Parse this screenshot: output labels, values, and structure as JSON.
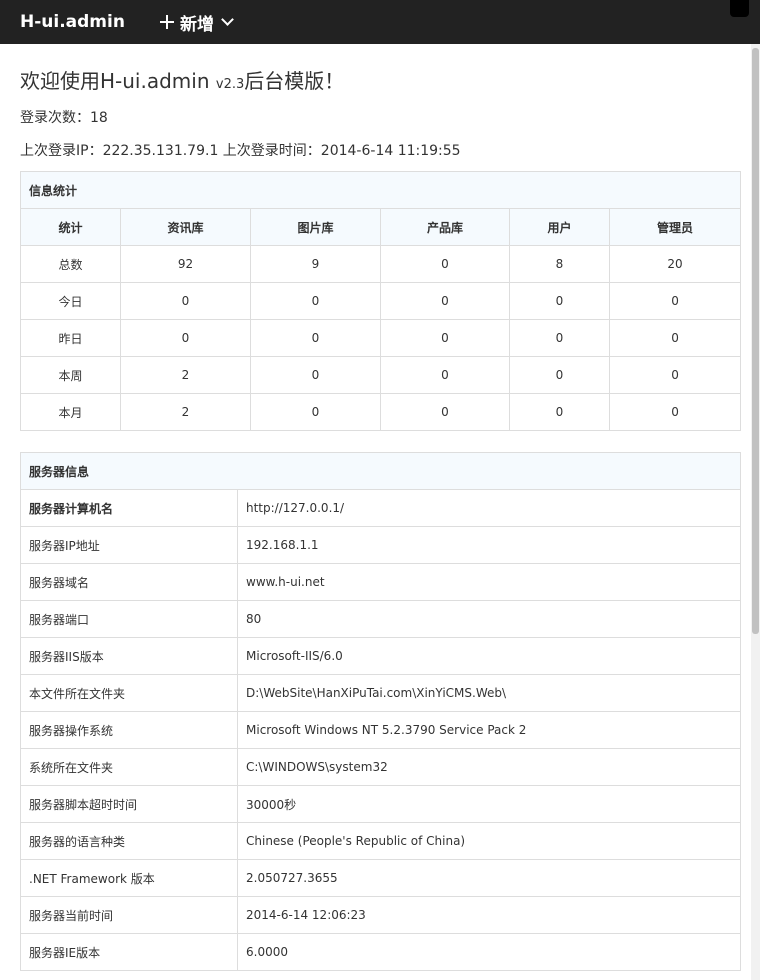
{
  "topbar": {
    "brand": "H-ui.admin",
    "add_label": "新增"
  },
  "welcome": {
    "prefix": "欢迎使用H-ui.admin ",
    "version": "v2.3",
    "suffix": "后台模版！"
  },
  "login_count": "登录次数：18",
  "last_login": "上次登录IP：222.35.131.79.1 上次登录时间：2014-6-14 11:19:55",
  "stats": {
    "caption": "信息统计",
    "headers": [
      "统计",
      "资讯库",
      "图片库",
      "产品库",
      "用户",
      "管理员"
    ],
    "rows": [
      [
        "总数",
        "92",
        "9",
        "0",
        "8",
        "20"
      ],
      [
        "今日",
        "0",
        "0",
        "0",
        "0",
        "0"
      ],
      [
        "昨日",
        "0",
        "0",
        "0",
        "0",
        "0"
      ],
      [
        "本周",
        "2",
        "0",
        "0",
        "0",
        "0"
      ],
      [
        "本月",
        "2",
        "0",
        "0",
        "0",
        "0"
      ]
    ]
  },
  "server": {
    "caption": "服务器信息",
    "rows": [
      [
        "服务器计算机名",
        "http://127.0.0.1/"
      ],
      [
        "服务器IP地址",
        "192.168.1.1"
      ],
      [
        "服务器域名",
        "www.h-ui.net"
      ],
      [
        "服务器端口",
        "80"
      ],
      [
        "服务器IIS版本",
        "Microsoft-IIS/6.0"
      ],
      [
        "本文件所在文件夹",
        "D:\\WebSite\\HanXiPuTai.com\\XinYiCMS.Web\\"
      ],
      [
        "服务器操作系统",
        "Microsoft Windows NT 5.2.3790 Service Pack 2"
      ],
      [
        "系统所在文件夹",
        "C:\\WINDOWS\\system32"
      ],
      [
        "服务器脚本超时时间",
        "30000秒"
      ],
      [
        "服务器的语言种类",
        "Chinese (People's Republic of China)"
      ],
      [
        ".NET Framework 版本",
        "2.050727.3655"
      ],
      [
        "服务器当前时间",
        "2014-6-14 12:06:23"
      ],
      [
        "服务器IE版本",
        "6.0000"
      ]
    ]
  }
}
